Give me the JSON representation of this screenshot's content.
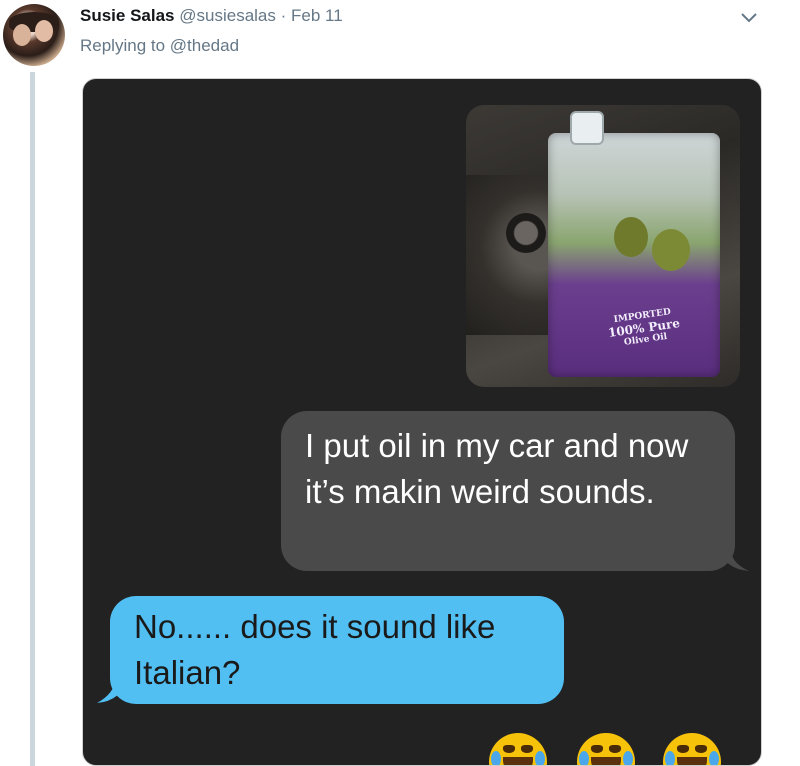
{
  "tweet": {
    "display_name": "Susie Salas",
    "handle": "@susiesalas",
    "separator": "·",
    "date": "Feb 11",
    "replying_label": "Replying to",
    "replying_handle": "@thedad"
  },
  "screenshot": {
    "photo_label_top": "IMPORTED",
    "photo_label_main": "100% Pure",
    "photo_label_sub": "Olive Oil",
    "messages": [
      {
        "direction": "outgoing",
        "text": "I put oil in my car and now it’s makin weird sounds."
      },
      {
        "direction": "incoming",
        "text": "No...... does it sound like Italian?"
      }
    ],
    "reactions": [
      "face-with-tears-of-joy",
      "face-with-tears-of-joy",
      "face-with-tears-of-joy"
    ]
  },
  "icons": {
    "menu": "chevron-down-icon"
  },
  "colors": {
    "handle_gray": "#657786",
    "thread_line": "#ccd6dd",
    "screenshot_bg": "#222222",
    "outgoing_bubble": "#4a4a4a",
    "incoming_bubble": "#52bff3"
  }
}
